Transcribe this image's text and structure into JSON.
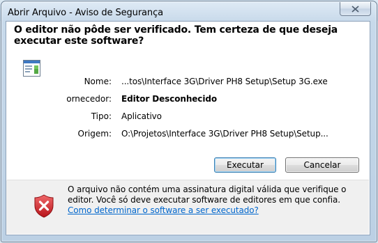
{
  "window": {
    "title": "Abrir Arquivo - Aviso de Segurança",
    "close_glyph": "✕"
  },
  "heading": "O editor não pôde ser verificado. Tem certeza de que deseja executar este software?",
  "icons": {
    "app": "application-icon",
    "warning": "shield-error-icon",
    "close": "close-icon"
  },
  "fields": {
    "name_label": "Nome:",
    "name_value": "...tos\\Interface 3G\\Driver PH8 Setup\\Setup 3G.exe",
    "publisher_label": "ornecedor:",
    "publisher_value": "Editor Desconhecido",
    "type_label": "Tipo:",
    "type_value": "Aplicativo",
    "origin_label": "Origem:",
    "origin_value": "O:\\Projetos\\Interface 3G\\Driver PH8 Setup\\Setup..."
  },
  "buttons": {
    "run": "Executar",
    "cancel": "Cancelar"
  },
  "footer": {
    "text": "O arquivo não contém uma assinatura digital válida que verifique o editor. Você só deve executar software de editores em que confia.",
    "link": "Como determinar o software a ser executado?"
  },
  "colors": {
    "link": "#0066cc",
    "shield_red": "#d9252a",
    "title_bg": "#c7d9ea"
  }
}
